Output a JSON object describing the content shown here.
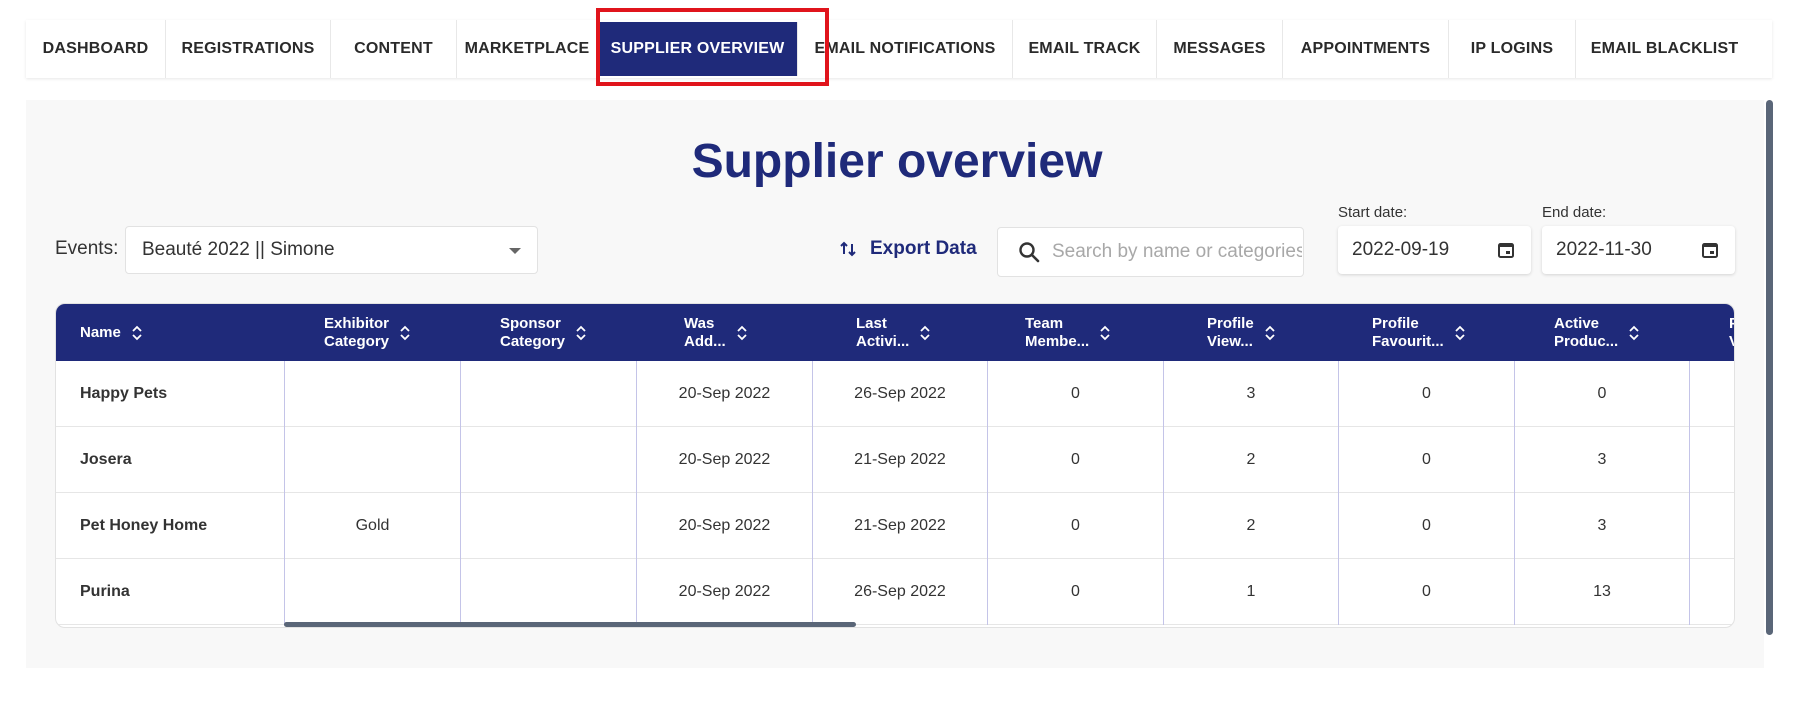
{
  "nav": {
    "items": [
      {
        "label": "DASHBOARD",
        "w": 140
      },
      {
        "label": "REGISTRATIONS",
        "w": 165
      },
      {
        "label": "CONTENT",
        "w": 126
      },
      {
        "label": "MARKETPLACE",
        "w": 141
      },
      {
        "label": "SUPPLIER OVERVIEW",
        "w": 200,
        "active": true
      },
      {
        "label": "EMAIL NOTIFICATIONS",
        "w": 215
      },
      {
        "label": "EMAIL TRACK",
        "w": 144
      },
      {
        "label": "MESSAGES",
        "w": 126
      },
      {
        "label": "APPOINTMENTS",
        "w": 166
      },
      {
        "label": "IP LOGINS",
        "w": 127
      },
      {
        "label": "EMAIL BLACKLIST",
        "w": 177
      }
    ]
  },
  "title": "Supplier overview",
  "events": {
    "label": "Events:",
    "value": "Beauté 2022 || Simone"
  },
  "export_label": "Export Data",
  "search": {
    "placeholder": "Search by name or categories"
  },
  "start_date": {
    "label": "Start date:",
    "value": "2022-09-19"
  },
  "end_date": {
    "label": "End date:",
    "value": "2022-11-30"
  },
  "table": {
    "columns": [
      "Name",
      "Exhibitor\nCategory",
      "Sponsor\nCategory",
      "Was\nAdd...",
      "Last\nActivi...",
      "Team\nMembe...",
      "Profile\nView...",
      "Profile\nFavourit...",
      "Active\nProduc...",
      "P\nV"
    ],
    "rows": [
      [
        "Happy Pets",
        "",
        "",
        "20-Sep 2022",
        "26-Sep 2022",
        "0",
        "3",
        "0",
        "0",
        ""
      ],
      [
        "Josera",
        "",
        "",
        "20-Sep 2022",
        "21-Sep 2022",
        "0",
        "2",
        "0",
        "3",
        ""
      ],
      [
        "Pet Honey Home",
        "Gold",
        "",
        "20-Sep 2022",
        "21-Sep 2022",
        "0",
        "2",
        "0",
        "3",
        ""
      ],
      [
        "Purina",
        "",
        "",
        "20-Sep 2022",
        "26-Sep 2022",
        "0",
        "1",
        "0",
        "13",
        ""
      ]
    ]
  }
}
